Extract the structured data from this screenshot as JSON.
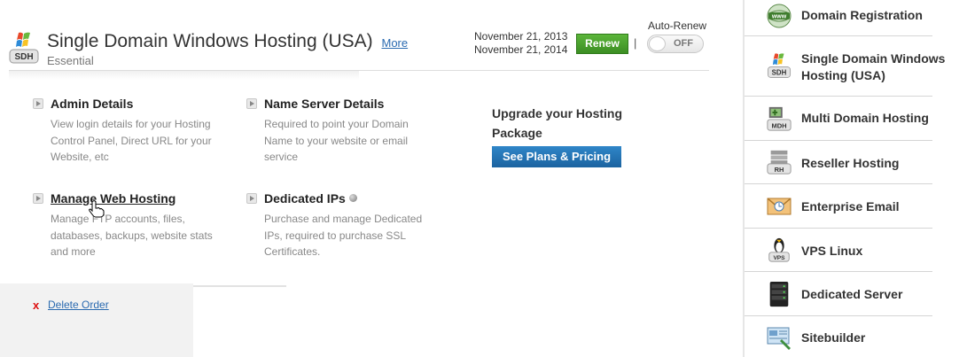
{
  "order": {
    "title": "Single Domain Windows Hosting (USA)",
    "more_label": "More",
    "plan": "Essential",
    "date_start": "November 21, 2013",
    "date_end": "November 21, 2014",
    "renew_label": "Renew",
    "separator": "|",
    "autorenew_label": "Auto-Renew",
    "autorenew_state": "OFF",
    "icon_text": "SDH"
  },
  "items": [
    {
      "title": "Admin Details",
      "desc": "View login details for your Hosting Control Panel, Direct URL for your Website, etc"
    },
    {
      "title": "Name Server Details",
      "desc": "Required to point your Domain Name to your website or email service"
    },
    {
      "title": "Manage Web Hosting",
      "desc": "Manage FTP accounts, files, databases, backups, website stats and more"
    },
    {
      "title": "Dedicated IPs",
      "desc": "Purchase and manage Dedicated IPs, required to purchase SSL Certificates."
    }
  ],
  "upgrade": {
    "heading": "Upgrade your Hosting Package",
    "button_label": "See Plans & Pricing"
  },
  "delete": {
    "x": "x",
    "label": "Delete Order"
  },
  "sidebar": {
    "items": [
      {
        "label": "Domain Registration",
        "icon": "www-globe-icon",
        "icon_text": "www"
      },
      {
        "label": "Single Domain Windows Hosting (USA)",
        "icon": "windows-sdh-icon",
        "icon_text": "SDH"
      },
      {
        "label": "Multi Domain Hosting",
        "icon": "mdh-icon",
        "icon_text": "MDH"
      },
      {
        "label": "Reseller Hosting",
        "icon": "rh-icon",
        "icon_text": "RH"
      },
      {
        "label": "Enterprise Email",
        "icon": "email-icon",
        "icon_text": ""
      },
      {
        "label": "VPS Linux",
        "icon": "vps-linux-icon",
        "icon_text": "VPS"
      },
      {
        "label": "Dedicated Server",
        "icon": "server-icon",
        "icon_text": ""
      },
      {
        "label": "Sitebuilder",
        "icon": "sitebuilder-icon",
        "icon_text": ""
      }
    ]
  },
  "colors": {
    "renew_green": "#3c8e23",
    "plans_blue": "#1b63a0",
    "link_blue": "#2a6ab0",
    "delete_red": "#dd1111"
  }
}
